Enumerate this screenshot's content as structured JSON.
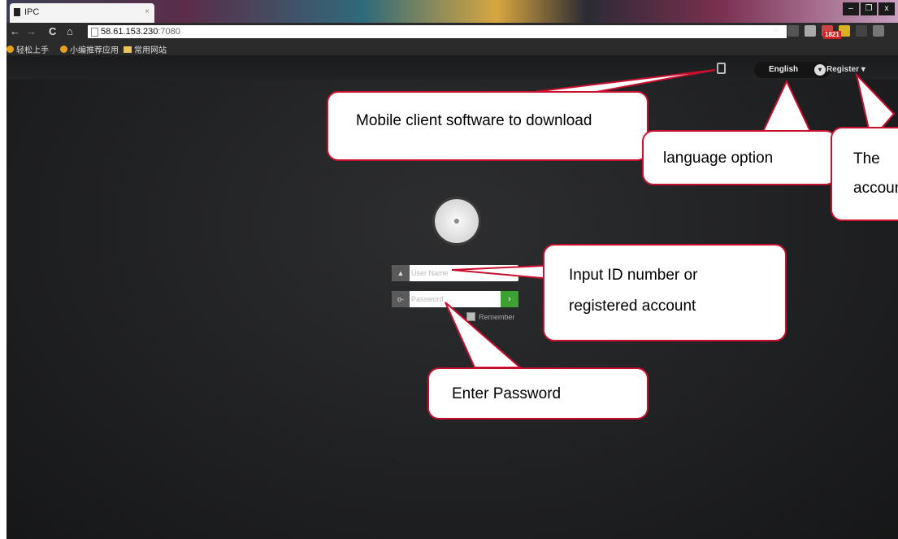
{
  "browser": {
    "tab_title": "IPC",
    "tab_close": "×",
    "url_host": "58.61.153.230",
    "url_port": ":7080",
    "nav": {
      "back": "←",
      "forward": "→",
      "reload": "C",
      "home": "⌂"
    },
    "window_buttons": [
      "–",
      "❐",
      "x"
    ],
    "extension_badge": "1821",
    "bookmarks": [
      "轻松上手",
      "小编推荐应用",
      "常用网站"
    ]
  },
  "header": {
    "language": "English",
    "register": "Register ▾"
  },
  "login": {
    "username_placeholder": "User Name",
    "password_placeholder": "Password",
    "go_label": "›",
    "remember_label": "Remember"
  },
  "callouts": {
    "mobile": "Mobile client software to download",
    "language": "language option",
    "register": "The account",
    "id": "Input ID number or registered account",
    "password": "Enter Password"
  },
  "colors": {
    "callout_border": "#c8102e",
    "go_button": "#3ca032"
  }
}
